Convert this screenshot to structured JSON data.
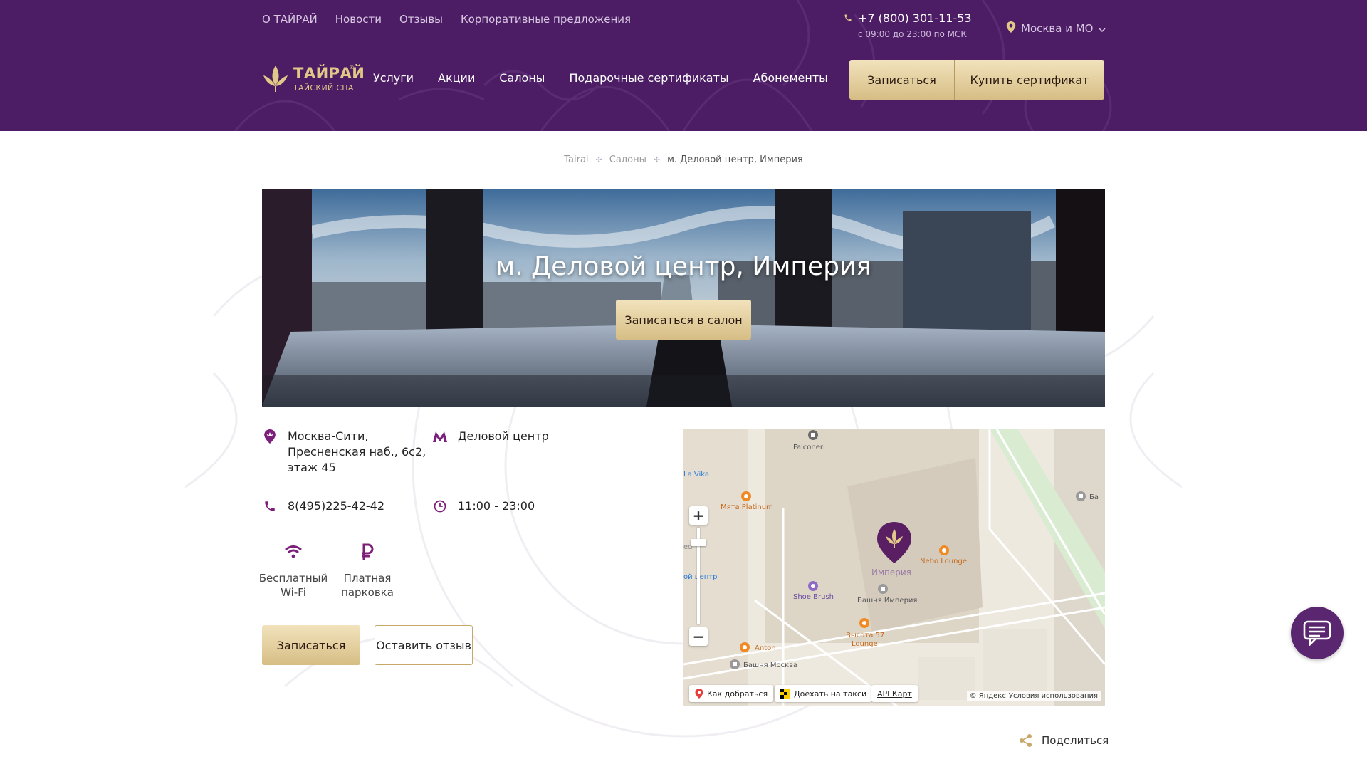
{
  "top_nav": [
    "О ТАЙРАЙ",
    "Новости",
    "Отзывы",
    "Корпоративные предложения"
  ],
  "phone": {
    "number": "+7 (800) 301-11-53",
    "hours": "с 09:00 до 23:00 по МСК"
  },
  "region": "Москва и МО",
  "logo": {
    "name": "ТАЙРАЙ",
    "sub": "ТАЙСКИЙ СПА",
    "reg": "®"
  },
  "main_nav": [
    "Услуги",
    "Акции",
    "Салоны",
    "Подарочные сертификаты",
    "Абонементы"
  ],
  "header_buttons": {
    "book": "Записаться",
    "certificate": "Купить сертификат"
  },
  "breadcrumb": [
    "Tairai",
    "Салоны",
    "м. Деловой центр, Империя"
  ],
  "hero": {
    "title": "м. Деловой центр, Империя",
    "button": "Записаться в салон"
  },
  "info": {
    "address": [
      "Москва-Сити,",
      "Пресненская наб., 6с2,",
      "этаж 45"
    ],
    "metro": "Деловой центр",
    "phone": "8(495)225-42-42",
    "hours": "11:00 - 23:00"
  },
  "features": [
    {
      "line1": "Бесплатный",
      "line2": "Wi-Fi"
    },
    {
      "line1": "Платная",
      "line2": "парковка"
    }
  ],
  "actions": {
    "book": "Записаться",
    "review": "Оставить отзыв"
  },
  "map": {
    "labels": [
      "Falconeri",
      "La Vika",
      "Мята Platinum",
      "Империя",
      "Nebo Lounge",
      "Shoe Brush",
      "Башня Империя",
      "Высота 57",
      "Lounge",
      "Anton",
      "Башня Москва",
      "Ба",
      "ой центр",
      "ed"
    ],
    "route_button": "Как добраться",
    "taxi_button": "Доехать на такси",
    "api_link": "API Карт",
    "copyright": "© Яндекс",
    "terms": "Условия использования",
    "zoom_in": "+",
    "zoom_out": "−"
  },
  "share": "Поделиться",
  "colors": {
    "header_bg": "#4c1d64",
    "gold": "#d6bd85",
    "accent": "#7b1f7a",
    "chat": "#5a2670"
  }
}
